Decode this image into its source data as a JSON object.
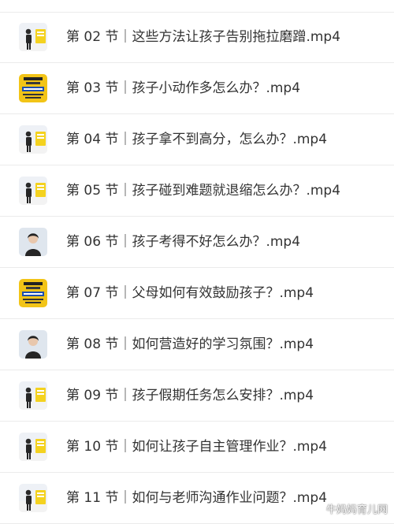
{
  "lessons": [
    {
      "title": "第 02 节｜这些方法让孩子告别拖拉磨蹭.mp4",
      "thumb": "teacher-standing-icon"
    },
    {
      "title": "第 03 节｜孩子小动作多怎么办？.mp4",
      "thumb": "yellow-poster-icon"
    },
    {
      "title": "第 04 节｜孩子拿不到高分，怎么办？.mp4",
      "thumb": "teacher-standing-icon"
    },
    {
      "title": "第 05 节｜孩子碰到难题就退缩怎么办？.mp4",
      "thumb": "teacher-standing-icon"
    },
    {
      "title": "第 06 节｜孩子考得不好怎么办？.mp4",
      "thumb": "teacher-portrait-icon"
    },
    {
      "title": "第 07 节｜父母如何有效鼓励孩子？.mp4",
      "thumb": "yellow-poster-icon"
    },
    {
      "title": "第 08 节｜如何营造好的学习氛围？.mp4",
      "thumb": "teacher-portrait-icon"
    },
    {
      "title": "第 09 节｜孩子假期任务怎么安排？.mp4",
      "thumb": "teacher-standing-icon"
    },
    {
      "title": "第 10 节｜如何让孩子自主管理作业？.mp4",
      "thumb": "teacher-standing-icon"
    },
    {
      "title": "第 11 节｜如何与老师沟通作业问题？.mp4",
      "thumb": "teacher-standing-icon"
    }
  ],
  "watermark": {
    "text": "牛妈妈育儿网",
    "icon": "wechat-icon"
  },
  "colors": {
    "text": "#333333",
    "divider": "#ebebeb",
    "thumb_bg": "#e9edf3",
    "poster_yellow": "#f2c417"
  }
}
